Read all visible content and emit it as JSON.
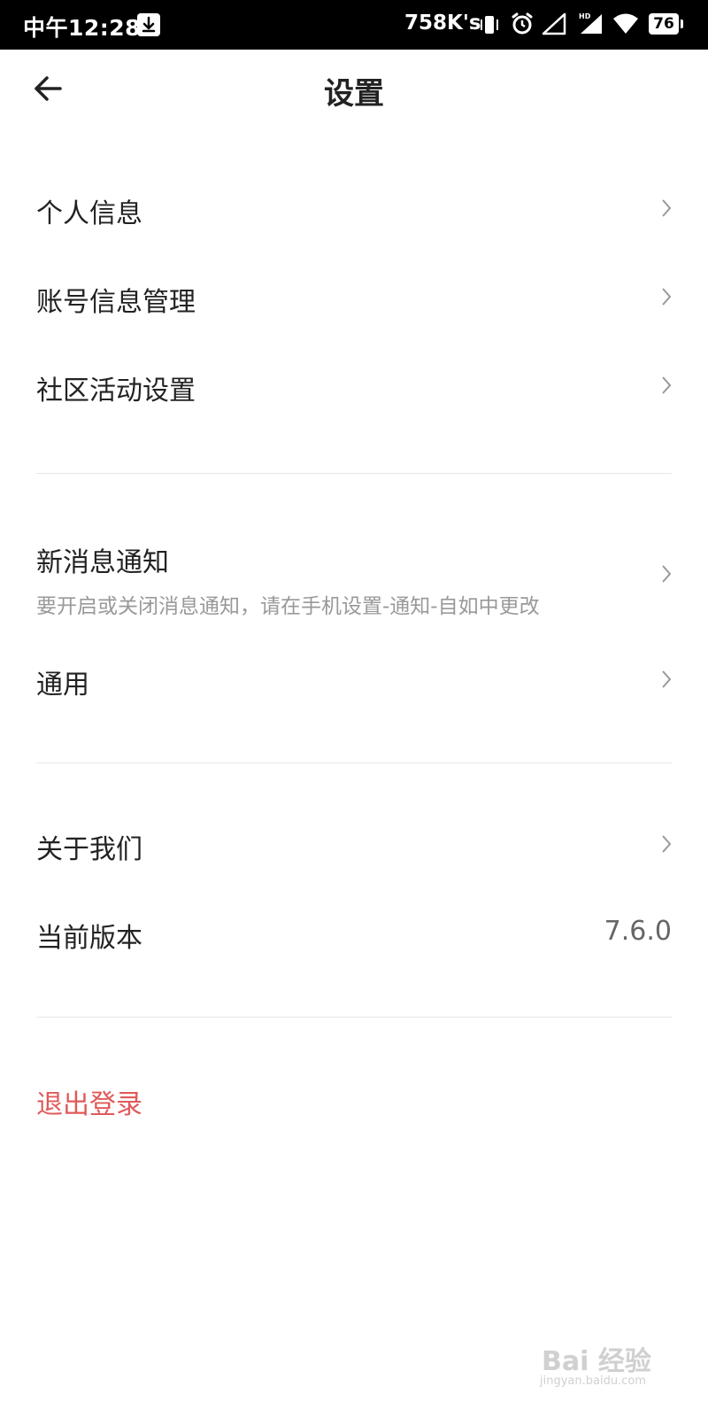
{
  "status_bar": {
    "time": "中午12:28",
    "net_speed": "758K's",
    "battery": "76"
  },
  "header": {
    "title": "设置"
  },
  "sections": {
    "personal_info": "个人信息",
    "account_manage": "账号信息管理",
    "community_settings": "社区活动设置",
    "notifications": {
      "label": "新消息通知",
      "hint": "要开启或关闭消息通知，请在手机设置-通知-自如中更改"
    },
    "general": "通用",
    "about": "关于我们",
    "version": {
      "label": "当前版本",
      "value": "7.6.0"
    },
    "logout": "退出登录"
  },
  "colors": {
    "logout": "#e05a5a",
    "divider": "#e6e6e6",
    "hint": "#999999"
  },
  "icons": [
    "back-arrow-icon",
    "chevron-right-icon",
    "download-icon",
    "vibrate-icon",
    "alarm-icon",
    "signal-icon",
    "wifi-icon",
    "battery-icon"
  ],
  "watermark": {
    "text": "Bai 经验",
    "sub": "jingyan.baidu.com"
  }
}
